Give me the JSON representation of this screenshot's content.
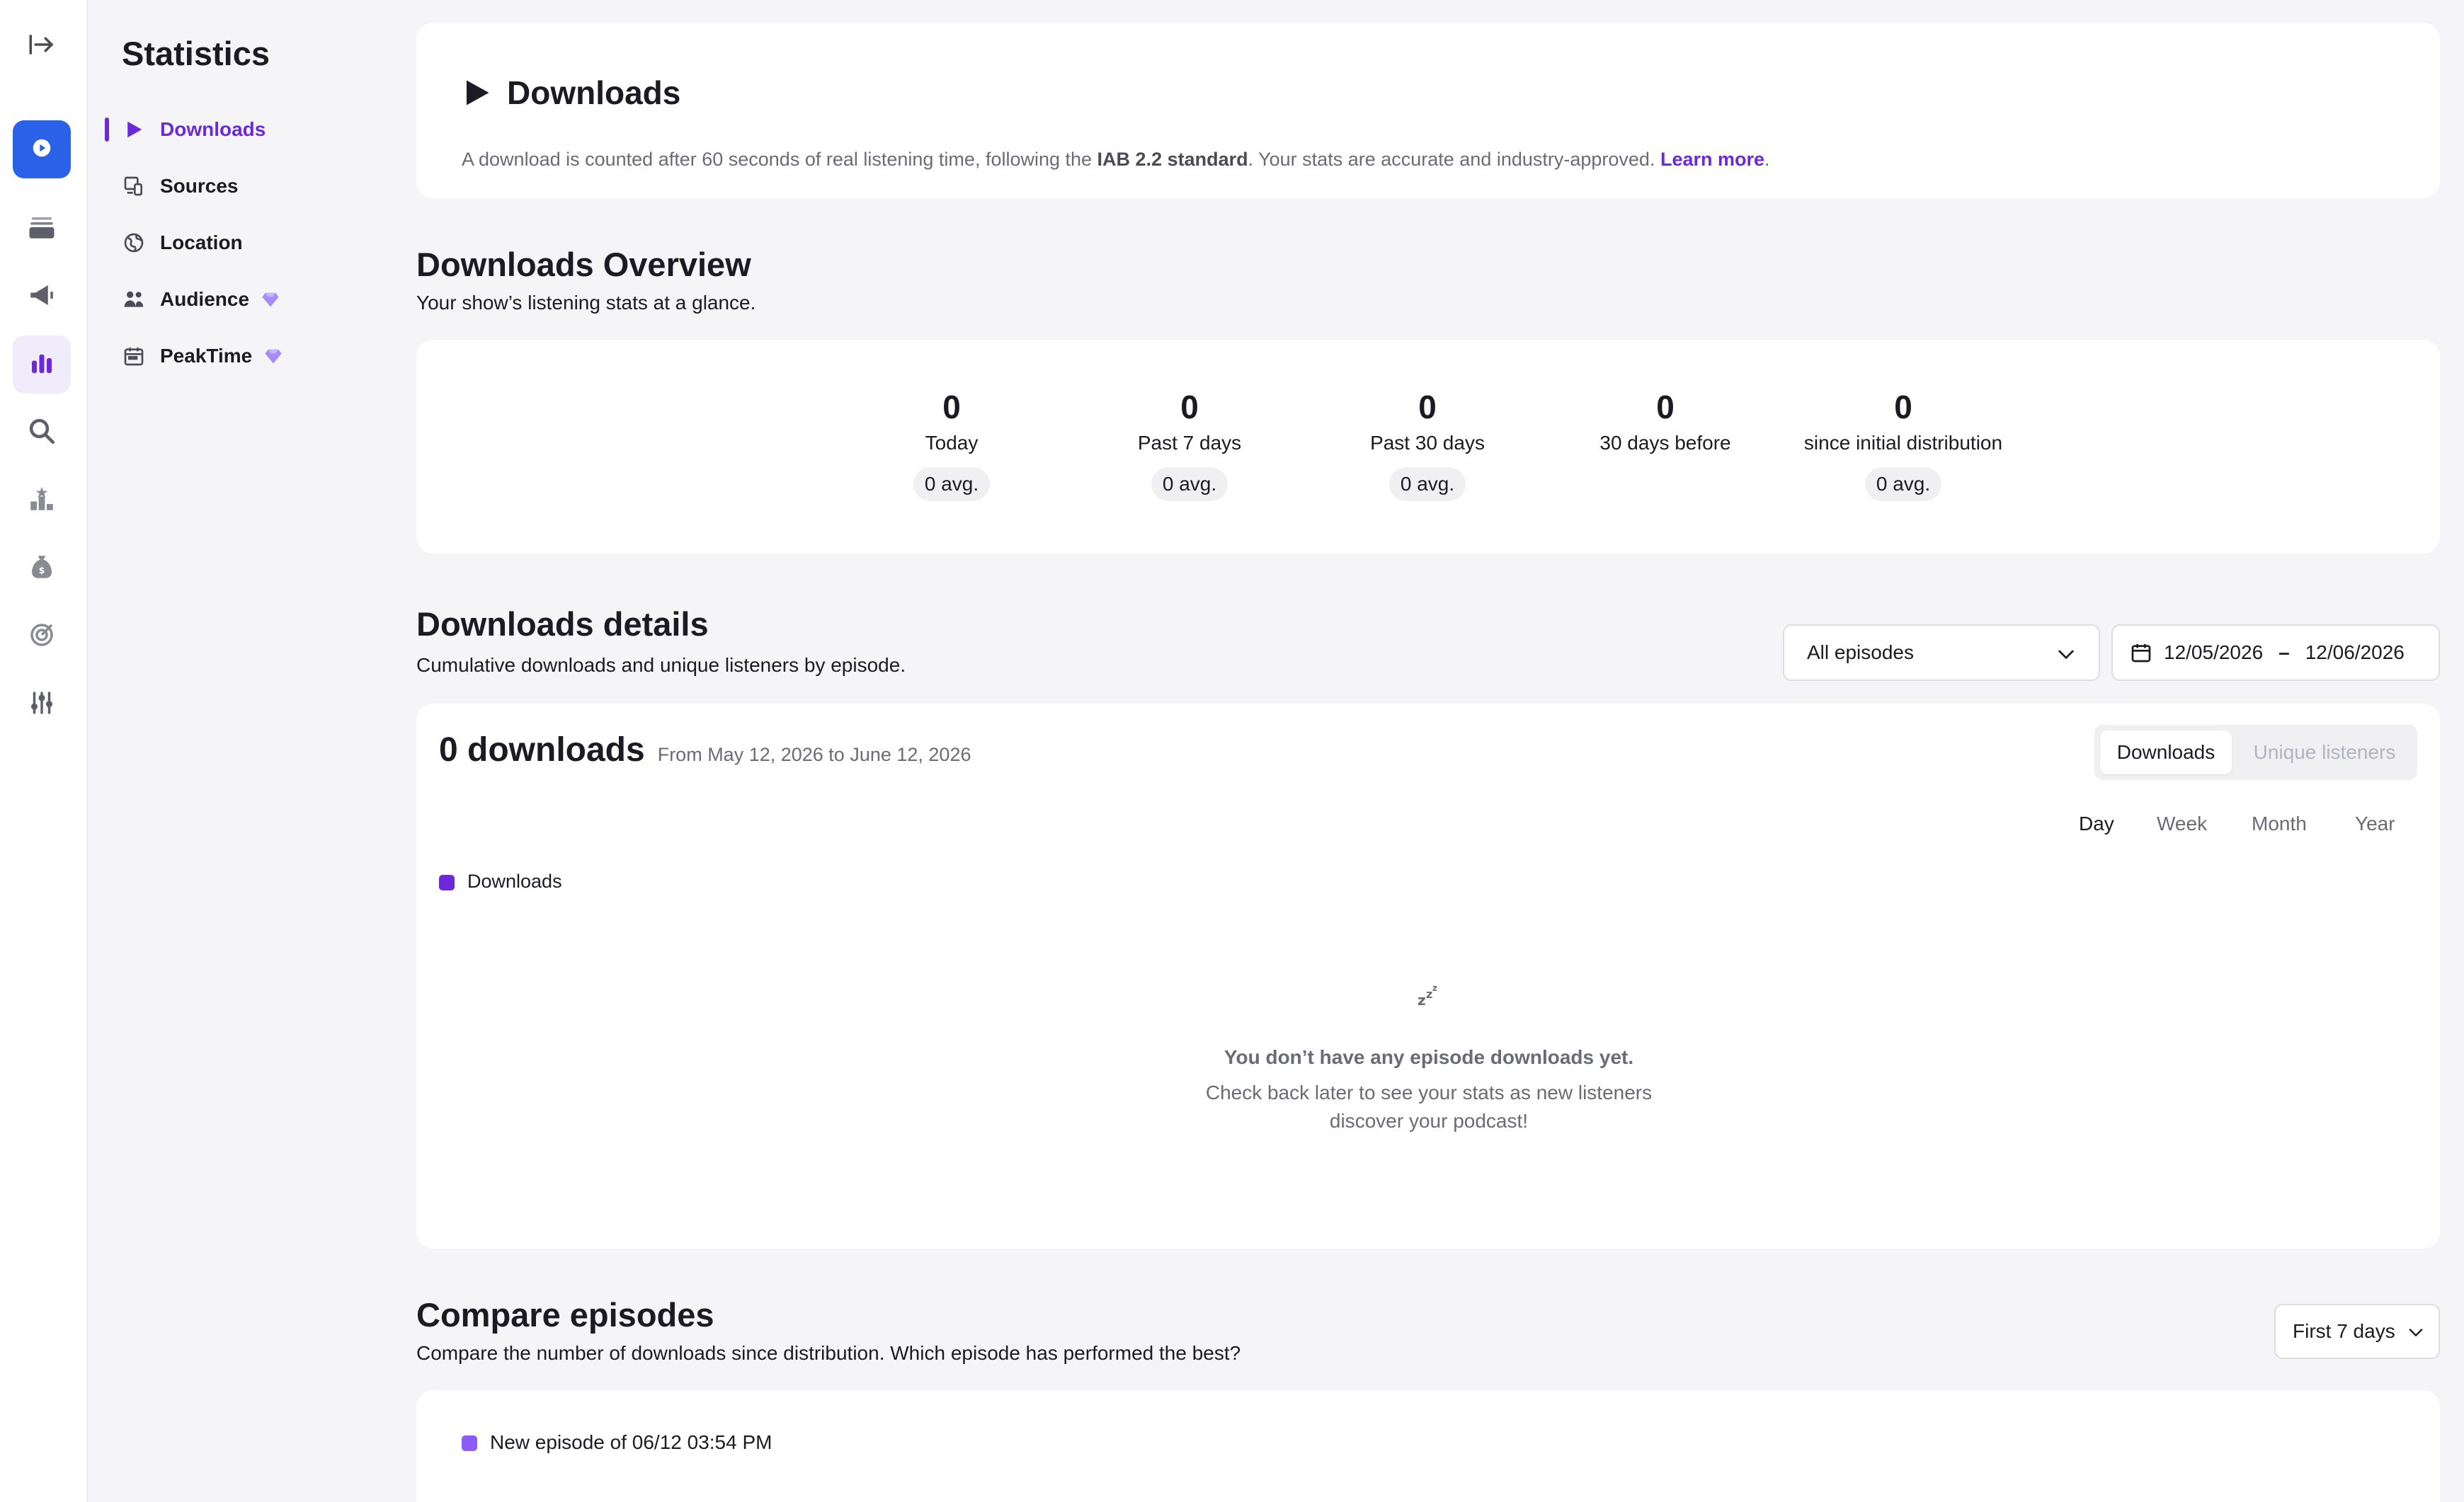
{
  "rail": {
    "items": [
      {
        "icon": "collapse-arrow-icon"
      },
      {
        "icon": "podcast-logo-icon"
      },
      {
        "icon": "episodes-stack-icon"
      },
      {
        "icon": "megaphone-icon"
      },
      {
        "icon": "bar-chart-icon"
      },
      {
        "icon": "search-icon"
      },
      {
        "icon": "ranking-icon"
      },
      {
        "icon": "money-bag-icon"
      },
      {
        "icon": "target-icon"
      },
      {
        "icon": "sliders-icon"
      }
    ]
  },
  "subnav": {
    "title": "Statistics",
    "items": [
      {
        "label": "Downloads",
        "icon": "play-icon",
        "active": true
      },
      {
        "label": "Sources",
        "icon": "devices-icon"
      },
      {
        "label": "Location",
        "icon": "globe-icon"
      },
      {
        "label": "Audience",
        "icon": "people-icon",
        "premium": true
      },
      {
        "label": "PeakTime",
        "icon": "calendar-icon",
        "premium": true
      }
    ]
  },
  "header": {
    "title": "Downloads",
    "desc_pre": "A download is counted after 60 seconds of real listening time, following the ",
    "desc_bold": "IAB 2.2 standard",
    "desc_post": ". Your stats are accurate and industry-approved. ",
    "link": "Learn more",
    "link_after": "."
  },
  "overview": {
    "title": "Downloads Overview",
    "subtitle": "Your show’s listening stats at a glance.",
    "stats": [
      {
        "value": "0",
        "label": "Today",
        "avg": "0 avg."
      },
      {
        "value": "0",
        "label": "Past 7 days",
        "avg": "0 avg."
      },
      {
        "value": "0",
        "label": "Past 30 days",
        "avg": "0 avg."
      },
      {
        "value": "0",
        "label": "30 days before",
        "avg": ""
      },
      {
        "value": "0",
        "label": "since initial distribution",
        "avg": "0 avg."
      }
    ]
  },
  "details": {
    "title": "Downloads details",
    "subtitle": "Cumulative downloads and unique listeners by episode.",
    "episode_select": "All episodes",
    "date_start": "12/05/2026",
    "date_sep": "–",
    "date_end": "12/06/2026",
    "total": "0 downloads",
    "range": "From May 12, 2026 to June 12, 2026",
    "toggle": {
      "downloads": "Downloads",
      "unique": "Unique listeners"
    },
    "periods": [
      "Day",
      "Week",
      "Month",
      "Year"
    ],
    "legend": "Downloads",
    "empty_icon": "zzz-icon",
    "empty_title": "You don’t have any episode downloads yet.",
    "empty_text": "Check back later to see your stats as new listeners discover your podcast!",
    "colors": {
      "accent": "#6d28d9",
      "legend": "#7c3aed"
    }
  },
  "compare": {
    "title": "Compare episodes",
    "subtitle": "Compare the number of downloads since distribution. Which episode has performed the best?",
    "select": "First 7 days",
    "legend": "New episode of 06/12 03:54 PM",
    "legend_color": "#8b5cf6"
  }
}
